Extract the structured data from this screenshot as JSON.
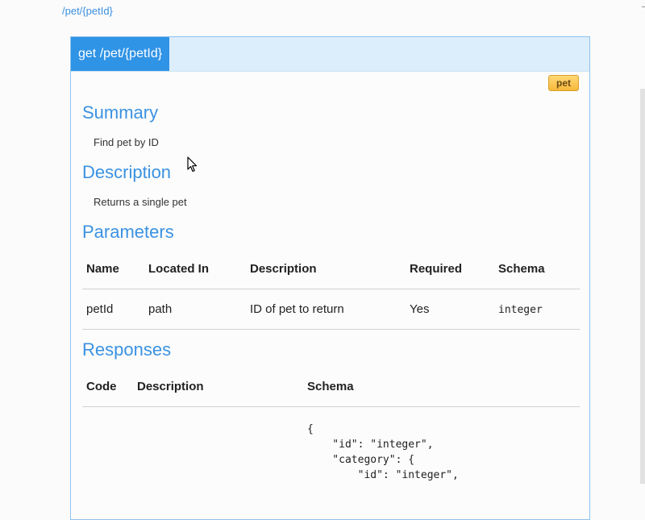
{
  "path_link": "/pet/{petId}",
  "operation": {
    "title": "get /pet/{petId}",
    "tag": "pet"
  },
  "summary": {
    "heading": "Summary",
    "text": "Find pet by ID"
  },
  "description": {
    "heading": "Description",
    "text": "Returns a single pet"
  },
  "parameters": {
    "heading": "Parameters",
    "columns": [
      "Name",
      "Located In",
      "Description",
      "Required",
      "Schema"
    ],
    "rows": [
      {
        "name": "petId",
        "located_in": "path",
        "description": "ID of pet to return",
        "required": "Yes",
        "schema": "integer"
      }
    ]
  },
  "responses": {
    "heading": "Responses",
    "columns": [
      "Code",
      "Description",
      "Schema"
    ],
    "schema_preview": "{\n    \"id\": \"integer\",\n    \"category\": {\n        \"id\": \"integer\","
  },
  "colors": {
    "accent": "#3a92e2",
    "header_bg": "#dcedfb",
    "title_bg": "#2f93e6",
    "tag_bg": "#f6b93a"
  },
  "icons": {
    "cursor": "mouse-pointer-icon"
  }
}
